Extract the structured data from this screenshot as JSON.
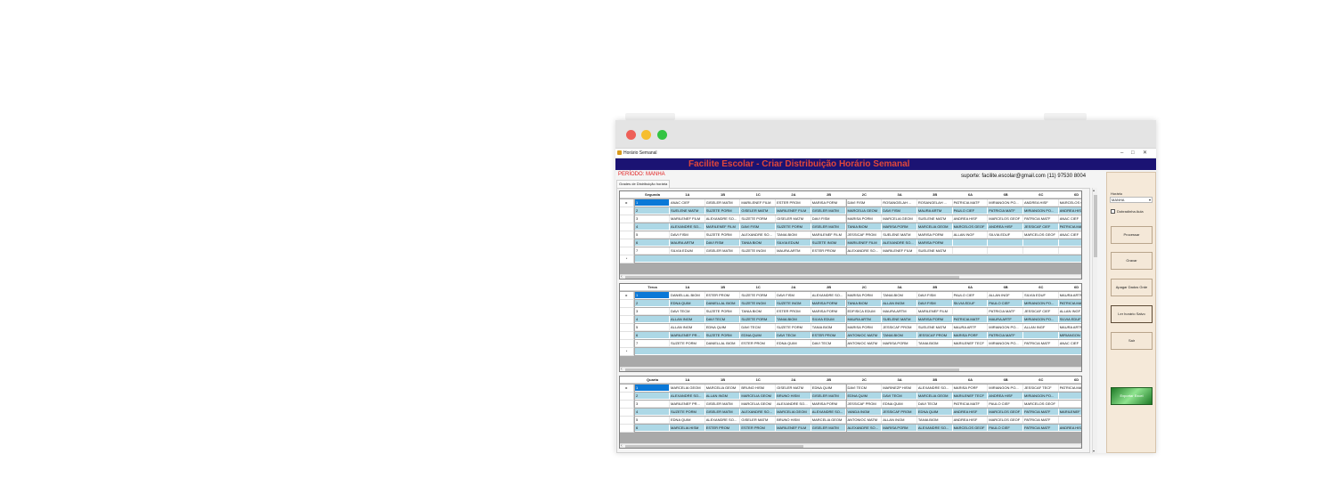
{
  "window": {
    "title": "Horário Semanal",
    "controls": {
      "minimize": "–",
      "maximize": "□",
      "close": "✕"
    },
    "banner": "Facilite Escolar - Criar Distribuição Horário Semanal",
    "periodo_label": "PERÍODO: MANHA",
    "suporte": "suporte: facilite.escolar@gmail.com (11) 97530 8004",
    "tab_label": "Grades de Distribuição horária"
  },
  "grid_icons": {
    "current_row": "▸",
    "new_row": "*",
    "scroll_left": "‹",
    "scroll_right": "›",
    "scroll_up": "▴",
    "scroll_down": "▾"
  },
  "columns": [
    "1A",
    "1B",
    "1C",
    "2A",
    "2B",
    "2C",
    "3A",
    "3B",
    "6A",
    "6B",
    "6C",
    "6D"
  ],
  "grids": [
    {
      "day": "Segunda",
      "rows": [
        {
          "num": "1",
          "cells": [
            "ANAC CIEF",
            "GISELER MATM",
            "MARILENEF FILM",
            "ESTER PROM",
            "MARISA PORM",
            "DAVI FISM",
            "ROSANGELAH ...",
            "ROSANGELAH ...",
            "PATRICIA MATF",
            "MIRIANGON PO...",
            "ANDREA HISF",
            "MARCELOS G..."
          ]
        },
        {
          "num": "2",
          "cells": [
            "SUELENE MATM",
            "SUZETE PORM",
            "GISELER MATM",
            "MARILENEF FILM",
            "GISELER MATM",
            "MARCELIA GEOM",
            "DAVI FISM",
            "MAURA ARTM",
            "PAULO CIEF",
            "PATRICIA MATF",
            "MIRIANGON PO...",
            "ANDREA HIS..."
          ]
        },
        {
          "num": "3",
          "cells": [
            "MARILENEF FILM",
            "ALEXANDRE SO...",
            "SUZETE PORM",
            "GISELER MATM",
            "DAVI FISM",
            "MARISA PORM",
            "MARCELIA GEOM",
            "SUELENE MATM",
            "ANDREA HISF",
            "MARCELOS GEOF",
            "PATRICIA MATF",
            "ANAC CIEF"
          ]
        },
        {
          "num": "4",
          "cells": [
            "ALEXANDRE SO...",
            "MARILENEF FILM",
            "DAVI FISM",
            "SUZETE PORM",
            "GISELER MATM",
            "TANIA BIOM",
            "MARISA PORM",
            "MARCELIA GEOM",
            "MARCELOS GEOF",
            "ANDREA HISF",
            "JESSICAF CIEF",
            "PATRICIA MATF"
          ]
        },
        {
          "num": "5",
          "cells": [
            "DAVI FISM",
            "SUZETE PORM",
            "ALEXANDRE SO...",
            "TANIA BIOM",
            "MARILENEF FILM",
            "JESSICAF PROM",
            "SUELENE MATM",
            "MARISA PORM",
            "ALLAN INGF",
            "SILVIA EDUF",
            "MARCELOS GEOF",
            "ANAC CIEF"
          ]
        },
        {
          "num": "6",
          "cells": [
            "MAURA ARTM",
            "DAVI FISM",
            "TANIA BIOM",
            "SILVIA EDUM",
            "SUZETE INGM",
            "MARILENEF FILM",
            "ALEXANDRE SO...",
            "MARISA PORM",
            "",
            "",
            "",
            ""
          ]
        },
        {
          "num": "7",
          "cells": [
            "SILVIA EDUM",
            "GISELER MATM",
            "SUZETE INGM",
            "MAURA ARTM",
            "ESTER PROM",
            "ALEXANDRE SO...",
            "MARILENEF FILM",
            "SUELENE MATM",
            "",
            "",
            "",
            ""
          ]
        }
      ]
    },
    {
      "day": "Terca",
      "rows": [
        {
          "num": "1",
          "cells": [
            "DANIELLAL BIOM",
            "ESTER PROM",
            "SUZETE PORM",
            "DAVI FISM",
            "ALEXANDRE SO...",
            "MARISA PORM",
            "TANIA BIOM",
            "DAVI FISM",
            "PAULO CIEF",
            "ALLAN INGF",
            "SILVIA EDUF",
            "MAURA ARTF"
          ]
        },
        {
          "num": "2",
          "cells": [
            "EDNA QUIM",
            "DANIELLAL BIOM",
            "SUZETE INGM",
            "SUZETE INGM",
            "MARISA PORM",
            "TANIA BIOM",
            "ALLAN INGM",
            "DAVI FISM",
            "SILVIA EDUF",
            "PAULO CIEF",
            "MIRIANGON PO...",
            "PATRICIA MATF"
          ]
        },
        {
          "num": "3",
          "cells": [
            "DAVI TECM",
            "SUZETE PORM",
            "TANIA BIOM",
            "ESTER PROM",
            "MARISA PORM",
            "EDFISICA EDUM",
            "MAURA ARTM",
            "MARILENEF FILM",
            "",
            "PATRICIA MATF",
            "JESSICAF CIEF",
            "ALLAN INGF"
          ]
        },
        {
          "num": "4",
          "cells": [
            "ALLAN INGM",
            "DAVI TECM",
            "SUZETE PORM",
            "TANIA BIOM",
            "SILVIA EDUM",
            "MAURA ARTM",
            "SUELENE MATM",
            "MARISA PORM",
            "PATRICIA MATF",
            "MAURA ARTF",
            "MIRIANGON PO...",
            "SILVIA EDUF"
          ]
        },
        {
          "num": "5",
          "cells": [
            "ALLAN INGM",
            "EDNA QUIM",
            "DAVI TECM",
            "SUZETE PORM",
            "TANIA BIOM",
            "MARISA PORM",
            "JESSICAF PROM",
            "SUELENE MATM",
            "MAURA ARTF",
            "MIRIANGON PO...",
            "ALLAN INGF",
            "MAURA ARTF"
          ]
        },
        {
          "num": "6",
          "cells": [
            "MARILENEF PR...",
            "SUZETE PORM",
            "EDNA QUIM",
            "DAVI TECM",
            "ESTER PROM",
            "ANTONIOC MATM",
            "TANIA BIOM",
            "JESSICAF PROM",
            "MARISA PORF",
            "PATRICIA MATF",
            "",
            "MIRIANGON PO..."
          ]
        },
        {
          "num": "7",
          "cells": [
            "SUZETE PORM",
            "DANIELLAL BIOM",
            "ESTER PROM",
            "EDNA QUIM",
            "DAVI TECM",
            "ANTONIOC MATM",
            "MARISA PORM",
            "TANIA BIOM",
            "MARILENEF TECF",
            "MIRIANGON PO...",
            "PATRICIA MATF",
            "ANAC CIEF"
          ]
        }
      ]
    },
    {
      "day": "Quarta",
      "rows": [
        {
          "num": "1",
          "cells": [
            "MARCELIA GEOM",
            "MARCELIA GEOM",
            "BRUNO HISM",
            "GISELER MATM",
            "EDNA QUIM",
            "DAVI TECM",
            "MARINEZP HISM",
            "ALEXANDRE SO...",
            "MARISA PORF",
            "MIRIANGON PO...",
            "JESSICAF TECF",
            "PATRICIA MAT..."
          ]
        },
        {
          "num": "2",
          "cells": [
            "ALEXANDRE SO...",
            "ALLAN INGM",
            "MARCELIA GEOM",
            "BRUNO HISM",
            "GISELER MATM",
            "EDNA QUIM",
            "DAVI TECM",
            "MARCELIA GEOM",
            "MARILENEF TECF",
            "ANDREA HISF",
            "MIRIANGON PO..."
          ]
        },
        {
          "num": "3",
          "cells": [
            "MARILENEF PR...",
            "GISELER MATM",
            "MARCELIA GEOM",
            "ALEXANDRE SO...",
            "MARISA PORM",
            "JESSICAF PROM",
            "EDNA QUIM",
            "DAVI TECM",
            "PATRICIA MATF",
            "PAULO CIEF",
            "MARCELOS GEOF",
            ""
          ]
        },
        {
          "num": "4",
          "cells": [
            "SUZETE PORM",
            "GISELER MATM",
            "ALEXANDRE SO...",
            "MARCELIA GEOM",
            "ALEXANDRE SO...",
            "VANDA INGM",
            "JESSICAF PROM",
            "EDNA QUIM",
            "ANDREA HISF",
            "MARCELOS GEOF",
            "PATRICIA MATF",
            "MARILENEF T..."
          ]
        },
        {
          "num": "5",
          "cells": [
            "EDNA QUIM",
            "ALEXANDRE SO...",
            "GISELER MATM",
            "BRUNO HISM",
            "MARCELIA GEOM",
            "ANTONIOC MATM",
            "ALLAN INGM",
            "TANIA BIOM",
            "ANDREA HISF",
            "MARCELOS GEOF",
            "PATRICIA MATF",
            ""
          ]
        },
        {
          "num": "6",
          "cells": [
            "MARCELIA HISM",
            "ESTER PROM",
            "ESTER PROM",
            "MARILENEF FILM",
            "GISELER MATM",
            "ALEXANDRE SO...",
            "MARISA PORM",
            "ALEXANDRE SO...",
            "MARCELOS GEOF",
            "PAULO CIEF",
            "PATRICIA MATF",
            "ANDREA HIS..."
          ]
        }
      ]
    }
  ],
  "side": {
    "horario_label": "Horário",
    "horario_value": "MANHA",
    "checkbox_label": "Dobradinha Aula",
    "buttons": [
      "Processar",
      "Gravar",
      "Apagar Dados Grde",
      "Ler horário Salvo",
      "Sair"
    ],
    "export_label": "Exportar Excel"
  }
}
